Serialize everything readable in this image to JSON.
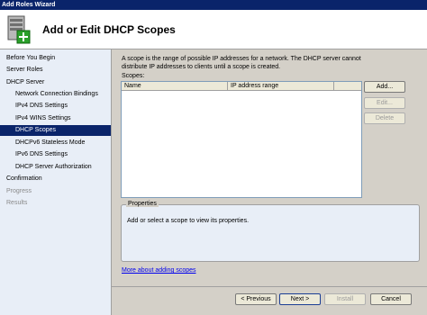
{
  "window": {
    "title": "Add Roles Wizard"
  },
  "header": {
    "title": "Add or Edit DHCP Scopes",
    "icon": "server-roles-icon"
  },
  "nav": {
    "items": [
      {
        "label": "Before You Begin",
        "state": "normal",
        "indent": false
      },
      {
        "label": "Server Roles",
        "state": "normal",
        "indent": false
      },
      {
        "label": "DHCP Server",
        "state": "normal",
        "indent": false
      },
      {
        "label": "Network Connection Bindings",
        "state": "normal",
        "indent": true
      },
      {
        "label": "IPv4 DNS Settings",
        "state": "normal",
        "indent": true
      },
      {
        "label": "IPv4 WINS Settings",
        "state": "normal",
        "indent": true
      },
      {
        "label": "DHCP Scopes",
        "state": "selected",
        "indent": true
      },
      {
        "label": "DHCPv6 Stateless Mode",
        "state": "normal",
        "indent": true
      },
      {
        "label": "IPv6 DNS Settings",
        "state": "normal",
        "indent": true
      },
      {
        "label": "DHCP Server Authorization",
        "state": "normal",
        "indent": true
      },
      {
        "label": "Confirmation",
        "state": "normal",
        "indent": false
      },
      {
        "label": "Progress",
        "state": "disabled",
        "indent": false
      },
      {
        "label": "Results",
        "state": "disabled",
        "indent": false
      }
    ]
  },
  "main": {
    "description": "A scope is the range of possible IP addresses for a network. The DHCP server cannot distribute IP addresses to clients until a scope is created.",
    "scopes_label": "Scopes:",
    "columns": [
      "Name",
      "IP address range"
    ],
    "rows": [],
    "buttons": {
      "add": "Add...",
      "edit": "Edit...",
      "delete": "Delete"
    },
    "properties": {
      "legend": "Properties",
      "text": "Add or select a scope to view its properties."
    },
    "more_link": "More about adding scopes"
  },
  "footer": {
    "previous": "< Previous",
    "next": "Next >",
    "install": "Install",
    "cancel": "Cancel"
  },
  "colors": {
    "titlebar": "#0a246a",
    "nav_bg": "#e8eef7",
    "selected": "#0a246a",
    "link": "#0000ee"
  }
}
